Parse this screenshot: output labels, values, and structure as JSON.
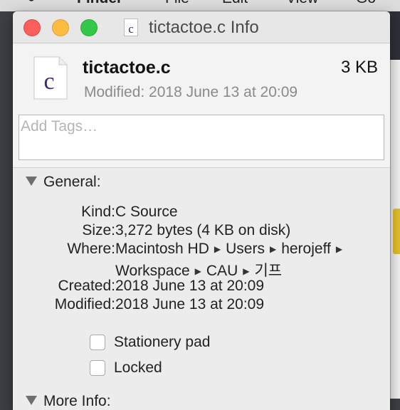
{
  "menubar": {
    "items": [
      "Finder",
      "File",
      "Edit",
      "View",
      "Go"
    ]
  },
  "window": {
    "title": "tictactoe.c Info",
    "title_icon_glyph": "c"
  },
  "header": {
    "file_name": "tictactoe.c",
    "file_size": "3 KB",
    "modified": "Modified: 2018 June 13 at 20:09",
    "icon_glyph": "c",
    "icon_color": "#3b2a7a"
  },
  "tags": {
    "placeholder": "Add Tags…",
    "value": ""
  },
  "general": {
    "label": "General:",
    "kind_label": "Kind:",
    "kind_value": "C Source",
    "size_label": "Size:",
    "size_value": "3,272 bytes (4 KB on disk)",
    "where_label": "Where:",
    "where_path": [
      "Macintosh HD",
      "Users",
      "herojeff",
      "Workspace",
      "CAU",
      "기프"
    ],
    "created_label": "Created:",
    "created_value": "2018 June 13 at 20:09",
    "modified_label": "Modified:",
    "modified_value": "2018 June 13 at 20:09",
    "stationery_label": "Stationery pad",
    "stationery_checked": false,
    "locked_label": "Locked",
    "locked_checked": false
  },
  "more_info": {
    "label": "More Info:"
  },
  "colors": {
    "close": "#fc605c",
    "minimize": "#fdbc40",
    "maximize": "#34c84a"
  }
}
